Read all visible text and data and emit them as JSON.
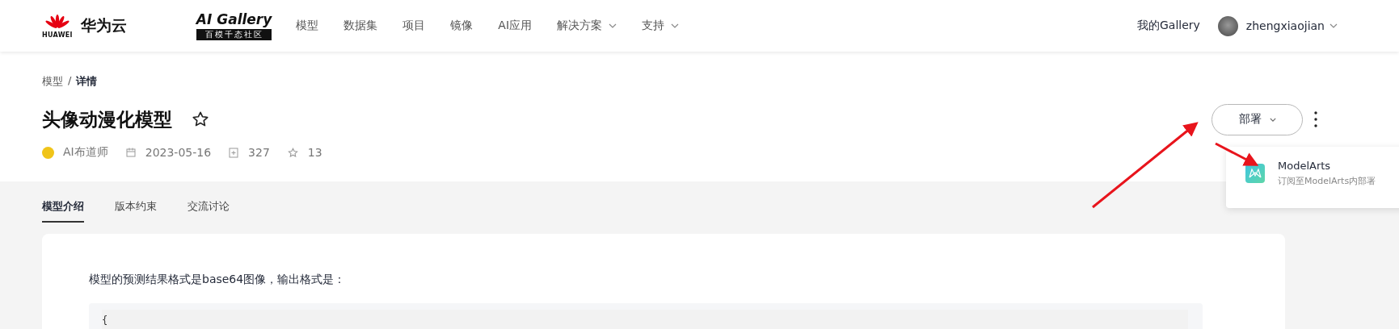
{
  "header": {
    "brand_mark": "HUAWEI",
    "brand_name": "华为云",
    "gallery_logo": "AI Gallery",
    "gallery_slogan": "百模千态社区",
    "nav": [
      {
        "label": "模型",
        "has_caret": false
      },
      {
        "label": "数据集",
        "has_caret": false
      },
      {
        "label": "项目",
        "has_caret": false
      },
      {
        "label": "镜像",
        "has_caret": false
      },
      {
        "label": "AI应用",
        "has_caret": false
      },
      {
        "label": "解决方案",
        "has_caret": true
      },
      {
        "label": "支持",
        "has_caret": true
      }
    ],
    "my_gallery": "我的Gallery",
    "username": "zhengxiaojian"
  },
  "breadcrumb": [
    "模型",
    "详情"
  ],
  "breadcrumb_separator": "/",
  "title": "头像动漫化模型",
  "favorited": false,
  "meta": {
    "author": "AI布道师",
    "date": "2023-05-16",
    "downloads": "327",
    "stars": "13"
  },
  "deploy_button": "部署",
  "deploy_menu": [
    {
      "title": "ModelArts",
      "subtitle": "订阅至ModelArts内部署"
    }
  ],
  "tabs": [
    {
      "label": "模型介绍",
      "selected": true
    },
    {
      "label": "版本约束",
      "selected": false
    },
    {
      "label": "交流讨论",
      "selected": false
    }
  ],
  "content": {
    "paragraph": "模型的预测结果格式是base64图像，输出格式是：",
    "code_first_line": "{"
  }
}
